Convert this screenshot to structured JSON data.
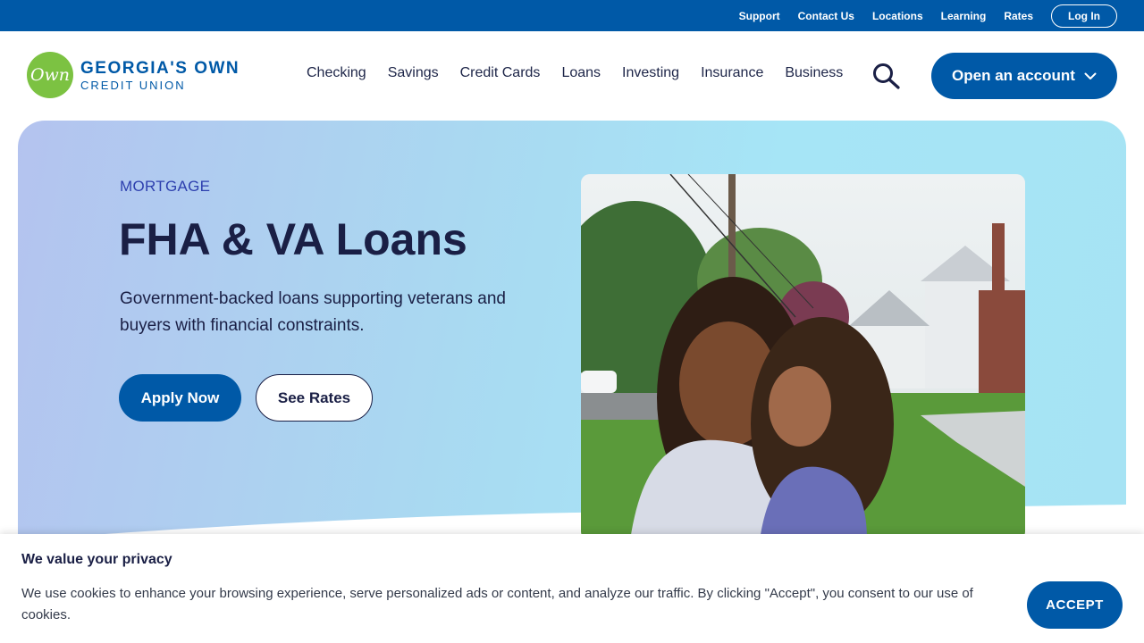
{
  "utility_bar": {
    "links": [
      "Support",
      "Contact Us",
      "Locations",
      "Learning",
      "Rates"
    ],
    "login_label": "Log In"
  },
  "logo": {
    "mark_text": "Own",
    "line1": "GEORGIA'S OWN",
    "line2": "CREDIT UNION"
  },
  "nav": {
    "items": [
      "Checking",
      "Savings",
      "Credit Cards",
      "Loans",
      "Investing",
      "Insurance",
      "Business"
    ],
    "cta_label": "Open an account"
  },
  "hero": {
    "eyebrow": "MORTGAGE",
    "title": "FHA & VA Loans",
    "subtitle": "Government-backed loans supporting veterans and buyers with financial constraints.",
    "primary_button": "Apply Now",
    "secondary_button": "See Rates"
  },
  "cookie_banner": {
    "title": "We value your privacy",
    "text": "We use cookies to enhance your browsing experience, serve personalized ads or content, and analyze our traffic. By clicking \"Accept\", you consent to our use of cookies.",
    "accept_label": "ACCEPT"
  },
  "colors": {
    "brand_blue": "#0059a7",
    "brand_green": "#7cc242",
    "navy_text": "#1a1f45"
  }
}
